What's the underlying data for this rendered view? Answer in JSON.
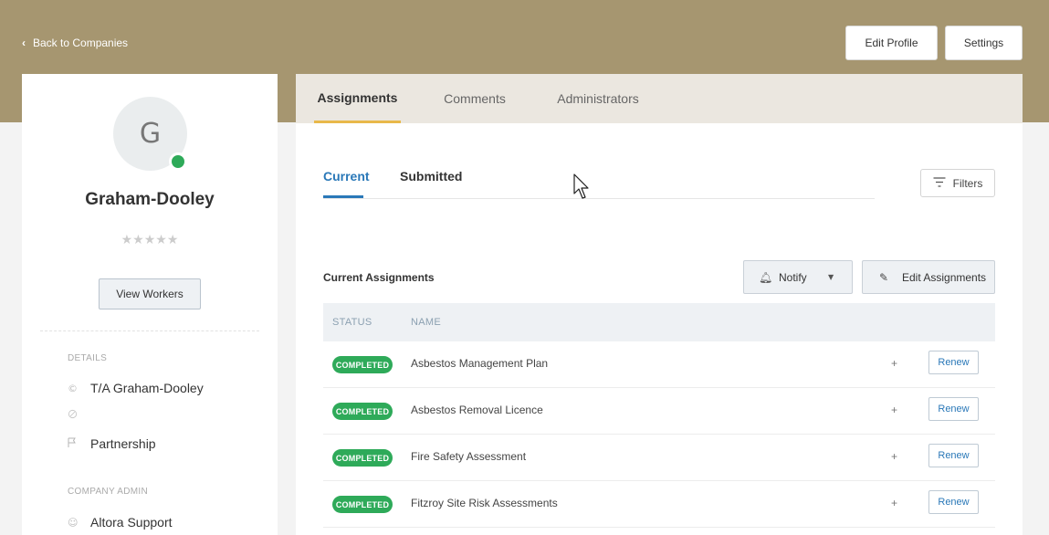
{
  "header": {
    "back_label": "Back to Companies",
    "edit_profile_label": "Edit Profile",
    "settings_label": "Settings"
  },
  "profile": {
    "avatar_letter": "G",
    "company_name": "Graham-Dooley",
    "rating_stars": "★★★★★",
    "rating_value": 0,
    "view_workers_label": "View Workers",
    "details_label": "DETAILS",
    "trading_as": "T/A Graham-Dooley",
    "website": "",
    "business_type": "Partnership",
    "company_admin_label": "COMPANY ADMIN",
    "admin_name": "Altora Support"
  },
  "tabs": [
    {
      "label": "Assignments",
      "active": true
    },
    {
      "label": "Comments",
      "active": false
    },
    {
      "label": "Administrators",
      "active": false
    }
  ],
  "subtabs": [
    {
      "label": "Current",
      "active": true
    },
    {
      "label": "Submitted",
      "active": false
    }
  ],
  "filters_label": "Filters",
  "assignments": {
    "title": "Current Assignments",
    "notify_label": "Notify",
    "edit_label": "Edit Assignments",
    "columns": [
      "STATUS",
      "NAME"
    ],
    "rows": [
      {
        "status": "COMPLETED",
        "name": "Asbestos Management Plan",
        "plus": "+",
        "action": "Renew"
      },
      {
        "status": "COMPLETED",
        "name": "Asbestos Removal Licence",
        "plus": "+",
        "action": "Renew"
      },
      {
        "status": "COMPLETED",
        "name": "Fire Safety Assessment",
        "plus": "+",
        "action": "Renew"
      },
      {
        "status": "COMPLETED",
        "name": "Fitzroy Site Risk Assessments",
        "plus": "+",
        "action": "Renew"
      }
    ]
  },
  "colors": {
    "banner": "#a69670",
    "status_completed": "#2eaa59",
    "active_tab_underline": "#e8b84a",
    "link_blue": "#2a78b8"
  },
  "icons": [
    "chevron-left-icon",
    "bell-icon",
    "caret-down-icon",
    "pencil-icon",
    "filter-icon",
    "copyright-icon",
    "link-icon",
    "flag-icon",
    "user-icon",
    "mouse-pointer-icon"
  ]
}
